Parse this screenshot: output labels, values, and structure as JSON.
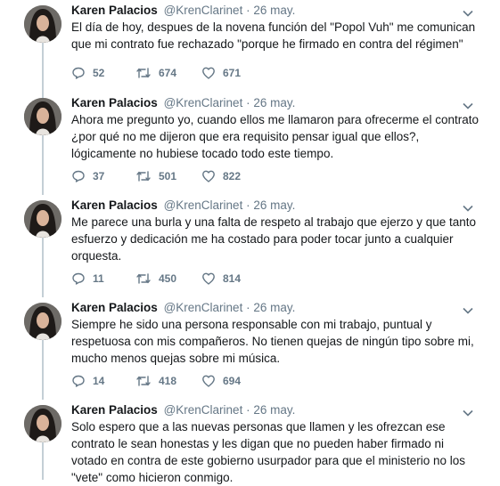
{
  "colors": {
    "text": "#14171a",
    "muted": "#657786",
    "line": "#c4cfd6"
  },
  "tweets": [
    {
      "name": "Karen Palacios",
      "handle": "@KrenClarinet",
      "sep": "·",
      "date": "26 may.",
      "text": "El día de hoy, despues de la novena función del \"Popol Vuh\" me comunican que mi contrato fue rechazado \"porque he firmado en contra del régimen\"",
      "replies": "52",
      "retweets": "674",
      "likes": "671"
    },
    {
      "name": "Karen Palacios",
      "handle": "@KrenClarinet",
      "sep": "·",
      "date": "26 may.",
      "text": "Ahora me pregunto yo, cuando ellos me llamaron para ofrecerme el contrato ¿por qué no me dijeron que era requisito pensar igual que ellos?, lógicamente no hubiese tocado todo este tiempo.",
      "replies": "37",
      "retweets": "501",
      "likes": "822"
    },
    {
      "name": "Karen Palacios",
      "handle": "@KrenClarinet",
      "sep": "·",
      "date": "26 may.",
      "text": "Me parece una burla y una falta de respeto al trabajo que ejerzo y que tanto esfuerzo y dedicación me ha costado para poder tocar junto a cualquier orquesta.",
      "replies": "11",
      "retweets": "450",
      "likes": "814"
    },
    {
      "name": "Karen Palacios",
      "handle": "@KrenClarinet",
      "sep": "·",
      "date": "26 may.",
      "text": "Siempre he sido una persona responsable con mi trabajo, puntual y respetuosa con mis compañeros. No tienen quejas de ningún tipo sobre mi, mucho menos quejas sobre mi música.",
      "replies": "14",
      "retweets": "418",
      "likes": "694"
    },
    {
      "name": "Karen Palacios",
      "handle": "@KrenClarinet",
      "sep": "·",
      "date": "26 may.",
      "text": "Solo espero que a las nuevas personas que llamen y les ofrezcan ese contrato le sean honestas y les digan que no pueden haber firmado ni votado en contra de este gobierno usurpador para que el ministerio no los \"vete\" como hicieron conmigo."
    }
  ]
}
